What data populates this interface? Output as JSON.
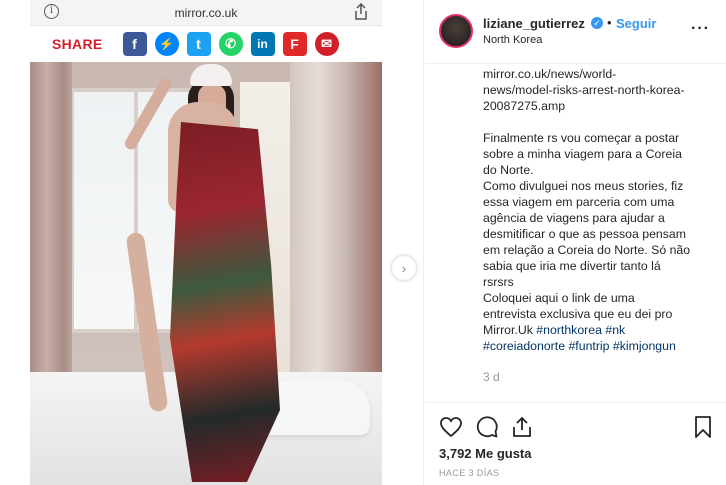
{
  "browser": {
    "url": "mirror.co.uk",
    "info_icon": "info-icon",
    "share_icon": "share-upload-icon"
  },
  "share_bar": {
    "label": "SHARE",
    "networks": [
      {
        "name": "facebook-icon",
        "glyph": "f",
        "color": "#3b5998"
      },
      {
        "name": "messenger-icon",
        "glyph": "⚡",
        "color": "#0084ff"
      },
      {
        "name": "twitter-icon",
        "glyph": "t",
        "color": "#1da1f2"
      },
      {
        "name": "whatsapp-icon",
        "glyph": "✆",
        "color": "#25d366"
      },
      {
        "name": "linkedin-icon",
        "glyph": "in",
        "color": "#0077b5"
      },
      {
        "name": "flipboard-icon",
        "glyph": "F",
        "color": "#e12828"
      },
      {
        "name": "email-icon",
        "glyph": "✉",
        "color": "#d11f2b"
      }
    ]
  },
  "post": {
    "username": "liziane_gutierrez",
    "follow_label": "Seguir",
    "location": "North Korea",
    "caption_lines": [
      "mirror.co.uk/news/world-",
      "news/model-risks-arrest-north-korea-",
      "20087275.amp"
    ],
    "caption_body": [
      "Finalmente rs vou começar a postar",
      "sobre a minha viagem para a Coreia",
      "do Norte.",
      "Como divulguei nos meus stories, fiz",
      "essa viagem em parceria com uma",
      "agência de viagens para ajudar a",
      "desmitificar o que as pessoa pensam",
      "em relação a Coreia do Norte. Só não",
      "sabia que iria me divertir tanto lá",
      "rsrsrs",
      "Coloquei aqui o link de uma",
      "entrevista exclusiva que eu dei pro"
    ],
    "caption_tail_text": "Mirror.Uk ",
    "hashtags_line1": [
      "#northkorea",
      "#nk"
    ],
    "hashtags_line2": [
      "#coreiadonorte",
      "#funtrip",
      "#kimjongun"
    ],
    "relative_time": "3 d",
    "likes": "3,792 Me gusta",
    "posted_date": "HACE 3 DÍAS"
  }
}
